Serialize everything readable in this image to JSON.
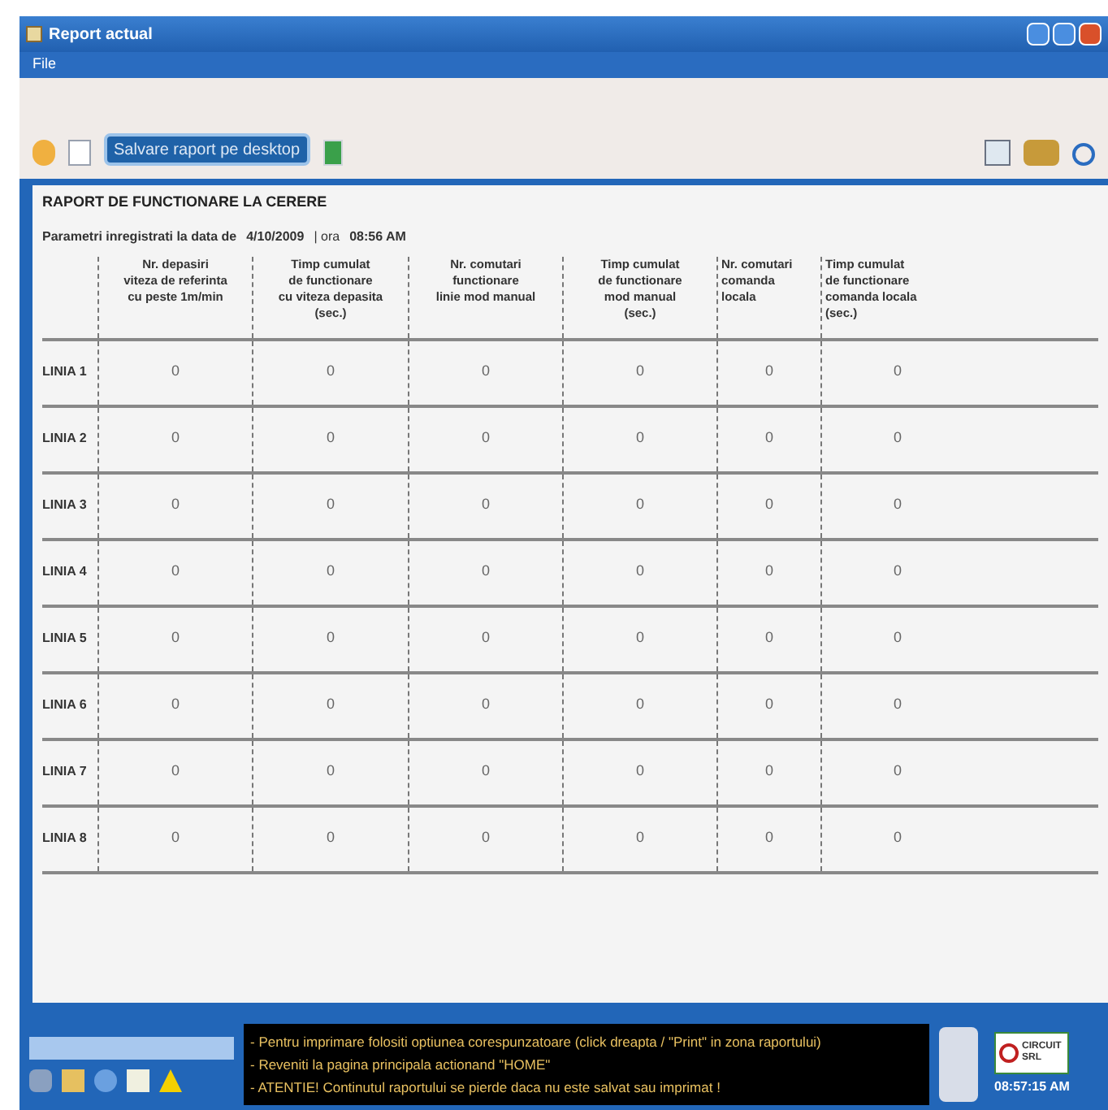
{
  "window": {
    "title": "Report actual"
  },
  "menu": [
    "File"
  ],
  "toolbar": {
    "save_button": "Salvare raport pe desktop"
  },
  "report": {
    "title": "RAPORT DE FUNCTIONARE LA CERERE",
    "date_label": "Parametri inregistrati la data de",
    "date": "4/10/2009",
    "time_label": "| ora",
    "time": "08:56 AM",
    "columns": [
      "Nr. depasiri\nviteza de referinta\ncu peste 1m/min",
      "Timp cumulat\nde functionare\ncu viteza depasita\n(sec.)",
      "Nr. comutari\nfunctionare\nlinie mod manual",
      "Timp cumulat\nde functionare\nmod manual\n(sec.)",
      "Nr. comutari\ncomanda\nlocala",
      "Timp cumulat\nde functionare\ncomanda locala\n(sec.)"
    ],
    "rows": [
      {
        "label": "LINIA 1",
        "cells": [
          "0",
          "0",
          "0",
          "0",
          "0",
          "0"
        ]
      },
      {
        "label": "LINIA 2",
        "cells": [
          "0",
          "0",
          "0",
          "0",
          "0",
          "0"
        ]
      },
      {
        "label": "LINIA 3",
        "cells": [
          "0",
          "0",
          "0",
          "0",
          "0",
          "0"
        ]
      },
      {
        "label": "LINIA 4",
        "cells": [
          "0",
          "0",
          "0",
          "0",
          "0",
          "0"
        ]
      },
      {
        "label": "LINIA 5",
        "cells": [
          "0",
          "0",
          "0",
          "0",
          "0",
          "0"
        ]
      },
      {
        "label": "LINIA 6",
        "cells": [
          "0",
          "0",
          "0",
          "0",
          "0",
          "0"
        ]
      },
      {
        "label": "LINIA 7",
        "cells": [
          "0",
          "0",
          "0",
          "0",
          "0",
          "0"
        ]
      },
      {
        "label": "LINIA 8",
        "cells": [
          "0",
          "0",
          "0",
          "0",
          "0",
          "0"
        ]
      }
    ]
  },
  "status_bar": {
    "messages": [
      "- Pentru imprimare folositi optiunea corespunzatoare (click dreapta / \"Print\" in zona raportului)",
      "- Reveniti la pagina principala actionand \"HOME\"",
      "- ATENTIE! Continutul raportului se pierde daca nu este salvat sau imprimat !"
    ],
    "clock": "08:57:15 AM",
    "logo": [
      "CIRCUIT",
      "SRL"
    ]
  }
}
